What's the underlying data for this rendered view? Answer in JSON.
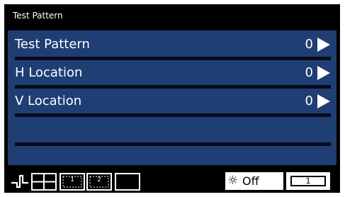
{
  "window": {
    "title": "Test Pattern"
  },
  "menu": {
    "items": [
      {
        "label": "Test Pattern",
        "value": "0"
      },
      {
        "label": "H Location",
        "value": "0"
      },
      {
        "label": "V Location",
        "value": "0"
      }
    ]
  },
  "status": {
    "pip1_label": "1",
    "pip2_label": "2",
    "brightness_label": "Off",
    "channel_value": "1"
  }
}
